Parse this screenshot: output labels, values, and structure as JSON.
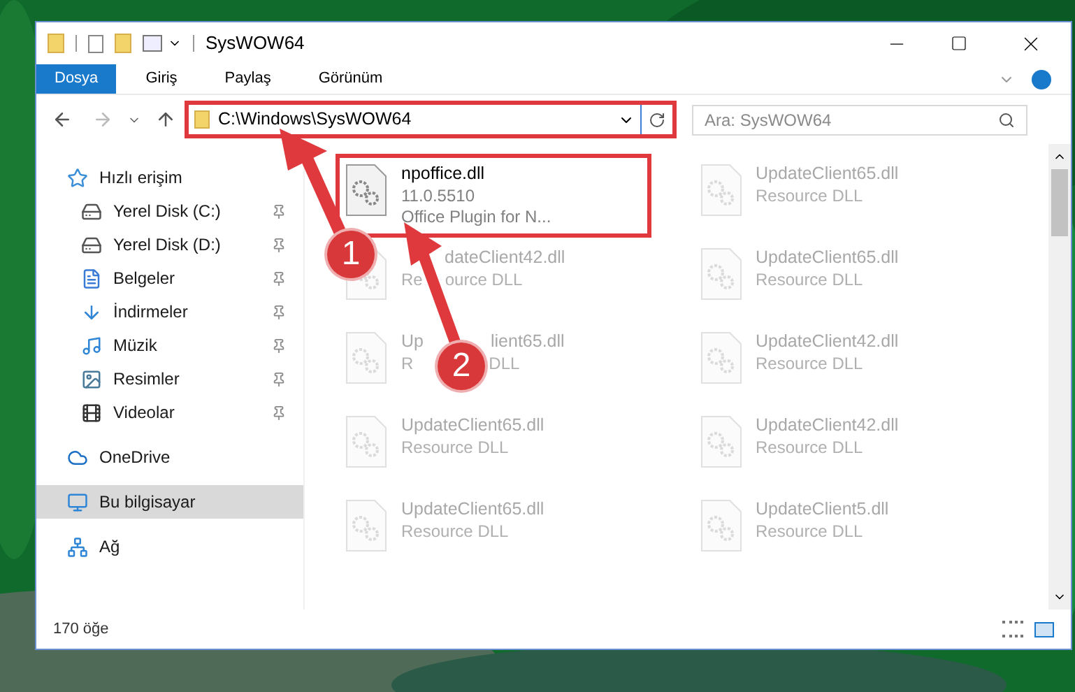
{
  "window": {
    "title": "SysWOW64"
  },
  "ribbon_tabs": [
    {
      "label": "Dosya",
      "selected": true
    },
    {
      "label": "Giriş",
      "selected": false
    },
    {
      "label": "Paylaş",
      "selected": false
    },
    {
      "label": "Görünüm",
      "selected": false
    }
  ],
  "address": {
    "value": "C:\\Windows\\SysWOW64"
  },
  "search": {
    "placeholder": "Ara: SysWOW64"
  },
  "sidebar": {
    "items": [
      {
        "kind": "section",
        "label": "Hızlı erişim",
        "selected": false,
        "children": [
          {
            "kind": "item",
            "label": "Yerel Disk (C:)",
            "pinned": true,
            "selected": false
          },
          {
            "kind": "item",
            "label": "Yerel Disk (D:)",
            "pinned": true,
            "selected": false
          },
          {
            "kind": "item",
            "label": "Belgeler",
            "pinned": true,
            "selected": false
          },
          {
            "kind": "item",
            "label": "İndirmeler",
            "pinned": true,
            "selected": false
          },
          {
            "kind": "item",
            "label": "Müzik",
            "pinned": true,
            "selected": false
          },
          {
            "kind": "item",
            "label": "Resimler",
            "pinned": true,
            "selected": false
          },
          {
            "kind": "item",
            "label": "Videolar",
            "pinned": true,
            "selected": false
          }
        ]
      },
      {
        "kind": "section",
        "label": "OneDrive",
        "selected": false
      },
      {
        "kind": "section",
        "label": "Bu bilgisayar",
        "selected": true
      },
      {
        "kind": "section",
        "label": "Ağ",
        "selected": false
      }
    ]
  },
  "files": [
    {
      "name": [
        "npoffice.dll"
      ],
      "lines": [
        [
          "11.0.5510"
        ],
        [
          "Office Plugin for N..."
        ]
      ],
      "blurred": false
    },
    {
      "name": [
        "UpdateClient65.dll"
      ],
      "lines": [
        [
          "Resource DLL"
        ]
      ],
      "blurred": true
    },
    {
      "name": [
        "dateClient42.dll"
      ],
      "lines": [
        [
          "Re",
          "ource DLL"
        ]
      ],
      "blurred": true
    },
    {
      "name": [
        "UpdateClient65.dll"
      ],
      "lines": [
        [
          "Resource DLL"
        ]
      ],
      "blurred": true
    },
    {
      "name": [
        "Up",
        "lient65.dll"
      ],
      "lines": [
        [
          "R",
          "DLL"
        ]
      ],
      "blurred": true
    },
    {
      "name": [
        "UpdateClient42.dll"
      ],
      "lines": [
        [
          "Resource DLL"
        ]
      ],
      "blurred": true
    },
    {
      "name": [
        "UpdateClient65.dll"
      ],
      "lines": [
        [
          "Resource DLL"
        ]
      ],
      "blurred": true
    },
    {
      "name": [
        "UpdateClient42.dll"
      ],
      "lines": [
        [
          "Resource DLL"
        ]
      ],
      "blurred": true
    },
    {
      "name": [
        "UpdateClient65.dll"
      ],
      "lines": [
        [
          "Resource DLL"
        ]
      ],
      "blurred": true
    },
    {
      "name": [
        "UpdateClient5.dll"
      ],
      "lines": [
        [
          "Resource DLL"
        ]
      ],
      "blurred": true
    }
  ],
  "status_bar": {
    "count": "170 öğe"
  },
  "annotations": [
    {
      "label": "1"
    },
    {
      "label": "2"
    }
  ]
}
